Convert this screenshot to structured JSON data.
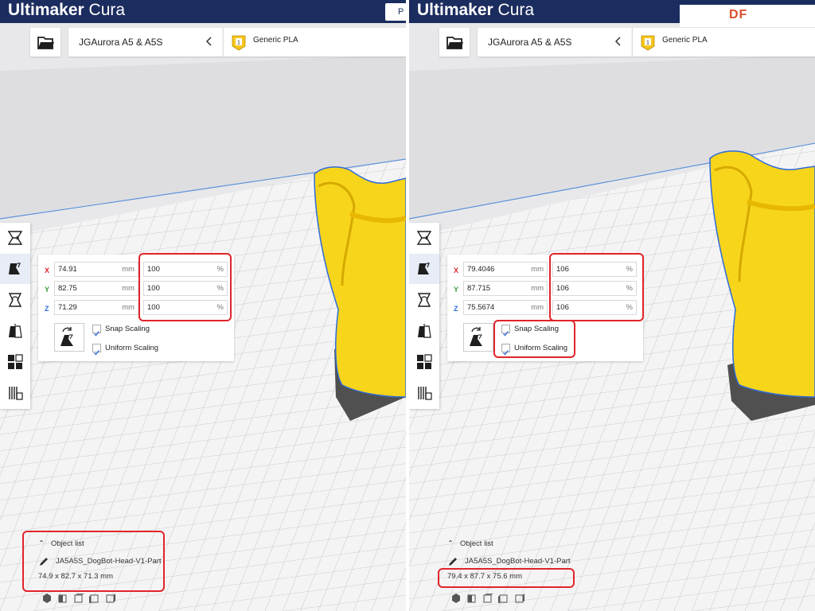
{
  "panels": [
    {
      "app_title": {
        "bold": "Ultimaker",
        "rest": " Cura"
      },
      "top_pill": "P",
      "printer": {
        "name": "JGAurora A5 & A5S"
      },
      "material": {
        "name": "Generic PLA",
        "extruder": "1"
      },
      "scale": {
        "x": {
          "axis": "X",
          "mm": "74.91",
          "unit_mm": "mm",
          "pct": "100",
          "unit_pct": "%"
        },
        "y": {
          "axis": "Y",
          "mm": "82.75",
          "unit_mm": "mm",
          "pct": "100",
          "unit_pct": "%"
        },
        "z": {
          "axis": "Z",
          "mm": "71.29",
          "unit_mm": "mm",
          "pct": "100",
          "unit_pct": "%"
        },
        "snap_label": "Snap Scaling",
        "uniform_label": "Uniform Scaling"
      },
      "object_list": {
        "header": "Object list",
        "file": "JA5A5S_DogBot-Head-V1-Part",
        "dims": "74.9 x 82.7 x 71.3 mm"
      }
    },
    {
      "app_title": {
        "bold": "Ultimaker",
        "rest": " Cura"
      },
      "logo": "DF",
      "printer": {
        "name": "JGAurora A5 & A5S"
      },
      "material": {
        "name": "Generic PLA",
        "extruder": "1"
      },
      "scale": {
        "x": {
          "axis": "X",
          "mm": "79.4046",
          "unit_mm": "mm",
          "pct": "106",
          "unit_pct": "%"
        },
        "y": {
          "axis": "Y",
          "mm": "87.715",
          "unit_mm": "mm",
          "pct": "106",
          "unit_pct": "%"
        },
        "z": {
          "axis": "Z",
          "mm": "75.5674",
          "unit_mm": "mm",
          "pct": "106",
          "unit_pct": "%"
        },
        "snap_label": "Snap Scaling",
        "uniform_label": "Uniform Scaling"
      },
      "object_list": {
        "header": "Object list",
        "file": "JA5A5S_DogBot-Head-V1-Part",
        "dims": "79.4 x 87.7 x 75.6 mm"
      }
    }
  ],
  "colors": {
    "topbar": "#1b2c5e",
    "accent_blue": "#2f6bd8",
    "axis_x": "#e0242a",
    "axis_y": "#3a9a3a",
    "axis_z": "#2f6bd8",
    "highlight": "#e0242a",
    "model_yellow": "#f7d51b"
  },
  "icons": {
    "open": "folder-icon",
    "chevron": "chevron-left-icon",
    "tools": [
      "move-icon",
      "scale-icon",
      "rotate-icon",
      "mirror-icon",
      "per-model-settings-icon",
      "support-blocker-icon"
    ]
  }
}
